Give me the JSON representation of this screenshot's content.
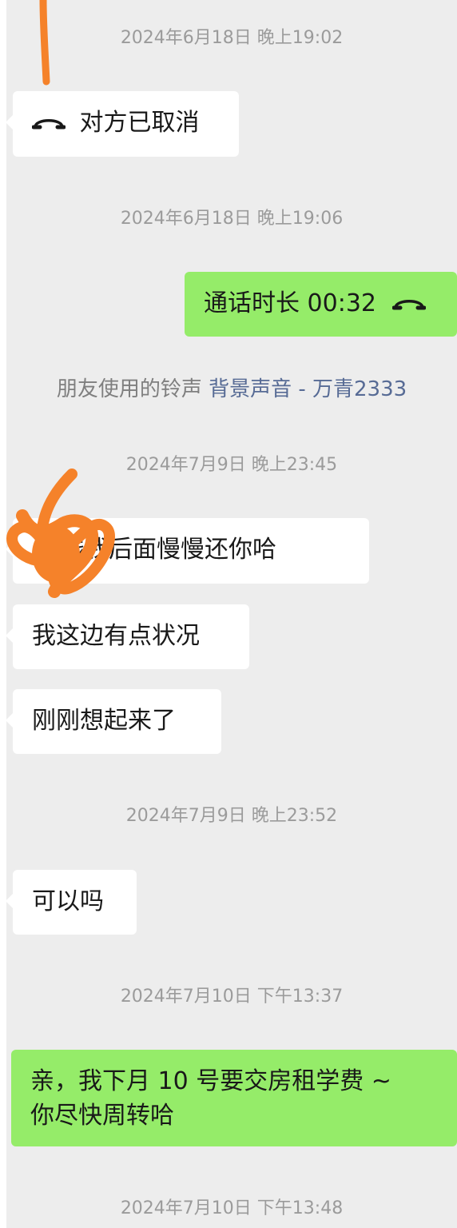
{
  "messages": {
    "t1": "2024年6月18日 晚上19:02",
    "m1_text": "对方已取消",
    "t2": "2024年6月18日 晚上19:06",
    "m2_text": "通话时长 00:32",
    "ringtone_prefix": "朋友使用的铃声",
    "ringtone_link": "背景声音 - 万青2333",
    "t3": "2024年7月9日 晚上23:45",
    "m3_text": "钱我后面慢慢还你哈",
    "m4_text": "我这边有点状况",
    "m5_text": "刚刚想起来了",
    "t4": "2024年7月9日 晚上23:52",
    "m6_text": "可以吗",
    "t5": "2024年7月10日 下午13:37",
    "m7_line1": "亲，我下月 10 号要交房租学费 ~",
    "m7_line2": "你尽快周转哈",
    "t6": "2024年7月10日 下午13:48"
  },
  "icons": {
    "call": "phone-hangup-icon",
    "scribble": "orange-scribble"
  },
  "colors": {
    "chat_background": "#ededed",
    "incoming_bubble": "#ffffff",
    "outgoing_bubble": "#95ec69",
    "timestamp": "#9b9b9b",
    "system_text": "#7f7f7f",
    "link_text": "#576b95",
    "scribble": "#f5822a"
  }
}
